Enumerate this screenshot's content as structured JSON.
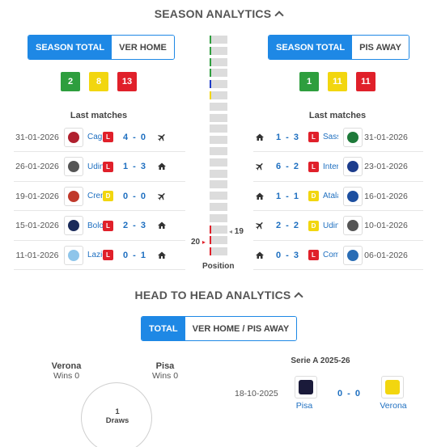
{
  "season": {
    "title": "SEASON ANALYTICS",
    "home": {
      "tabs": [
        "SEASON TOTAL",
        "VER HOME"
      ],
      "stats": {
        "wins": "2",
        "draws": "8",
        "losses": "13"
      },
      "last_title": "Last matches",
      "matches": [
        {
          "date": "31-01-2026",
          "team": "Cagliari",
          "result": "L",
          "score": "4 - 0",
          "venue": "plane-icon",
          "crest_color": "#b0202e"
        },
        {
          "date": "26-01-2026",
          "team": "Udinese",
          "result": "L",
          "score": "1 - 3",
          "venue": "home-icon",
          "crest_color": "#555555"
        },
        {
          "date": "19-01-2026",
          "team": "Cremonese",
          "result": "D",
          "score": "0 - 0",
          "venue": "plane-icon",
          "crest_color": "#c0392b"
        },
        {
          "date": "15-01-2026",
          "team": "Bologna",
          "result": "L",
          "score": "2 - 3",
          "venue": "home-icon",
          "crest_color": "#1a2a5a"
        },
        {
          "date": "11-01-2026",
          "team": "Lazio",
          "result": "L",
          "score": "0 - 1",
          "venue": "home-icon",
          "crest_color": "#8ec5ea"
        }
      ]
    },
    "away": {
      "tabs": [
        "SEASON TOTAL",
        "PIS AWAY"
      ],
      "stats": {
        "wins": "1",
        "draws": "11",
        "losses": "11"
      },
      "last_title": "Last matches",
      "matches": [
        {
          "date": "31-01-2026",
          "team": "Sassuolo",
          "result": "L",
          "score": "1 - 3",
          "venue": "home-icon",
          "crest_color": "#1e7a3a"
        },
        {
          "date": "23-01-2026",
          "team": "Inter",
          "result": "L",
          "score": "6 - 2",
          "venue": "plane-icon",
          "crest_color": "#1c3c8c"
        },
        {
          "date": "16-01-2026",
          "team": "Atalanta",
          "result": "D",
          "score": "1 - 1",
          "venue": "home-icon",
          "crest_color": "#1c4fa0"
        },
        {
          "date": "10-01-2026",
          "team": "Udinese",
          "result": "D",
          "score": "2 - 2",
          "venue": "plane-icon",
          "crest_color": "#555555"
        },
        {
          "date": "06-01-2026",
          "team": "Como",
          "result": "L",
          "score": "0 - 3",
          "venue": "home-icon",
          "crest_color": "#2a6db5"
        }
      ]
    },
    "position": {
      "label": "Position",
      "home_position": "20",
      "away_position": "19",
      "markers": {
        "green": [
          1,
          2,
          3,
          4
        ],
        "blue": [
          5
        ],
        "yellow": [
          6
        ],
        "red": [
          18,
          19,
          20
        ]
      }
    }
  },
  "h2h": {
    "title": "HEAD TO HEAD ANALYTICS",
    "tabs": [
      "TOTAL",
      "VER HOME / PIS AWAY"
    ],
    "home_team": "Verona",
    "home_wins": "Wins 0",
    "away_team": "Pisa",
    "away_wins": "Wins 0",
    "draws_count": "1",
    "draws_label": "Draws",
    "competition": "Serie A 2025-26",
    "match": {
      "date": "18-10-2025",
      "home": "Pisa",
      "score": "0 - 0",
      "away": "Verona"
    }
  }
}
